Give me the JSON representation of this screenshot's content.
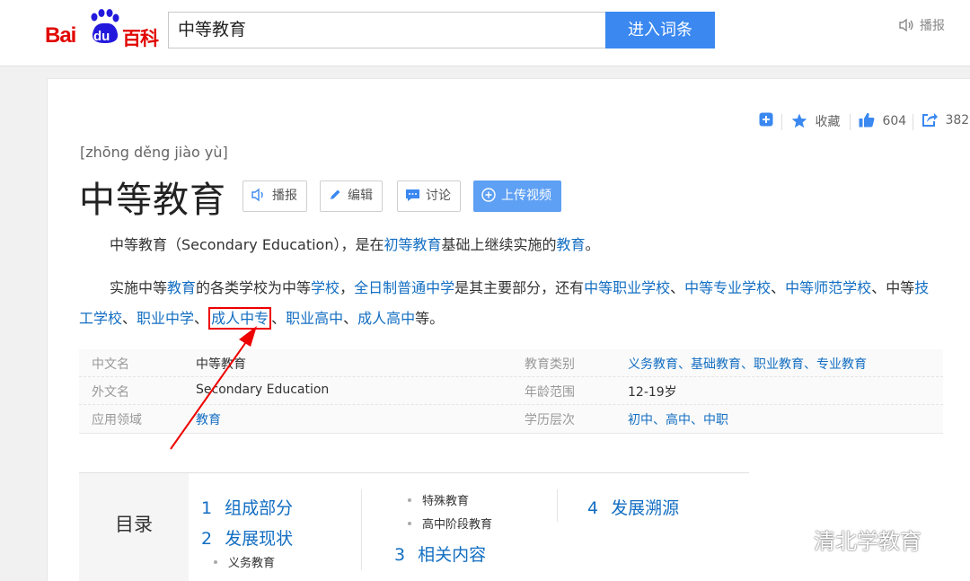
{
  "header": {
    "logo_bai": "Bai",
    "logo_du": "du",
    "logo_baike": "百科",
    "search_value": "中等教育",
    "search_button": "进入词条",
    "broadcast": "播报"
  },
  "tools": {
    "favorite": "收藏",
    "likes": "604",
    "shares": "382"
  },
  "entry": {
    "pinyin": "[zhōng děng jiào yù]",
    "title": "中等教育",
    "buttons": {
      "broadcast": "播报",
      "edit": "编辑",
      "discuss": "讨论",
      "upload_video": "上传视频"
    }
  },
  "summary": {
    "p1": {
      "t1": "中等教育（Secondary Education），是在",
      "l1": "初等教育",
      "t2": "基础上继续实施的",
      "l2": "教育",
      "t3": "。"
    },
    "p2": {
      "t1": "实施中等",
      "l1": "教育",
      "t2": "的各类学校为中等",
      "l2": "学校",
      "t3": "，",
      "l3": "全日制普通中学",
      "t4": "是其主要部分，还有",
      "l4": "中等职业学校",
      "t5": "、",
      "l5": "中等专业学校",
      "t6": "、",
      "l6": "中等师范学校",
      "t7": "、中等",
      "l7": "技工学校",
      "t8": "、",
      "l8": "职业中学",
      "t9": "、",
      "l9": "成人中专",
      "t10": "、",
      "l10": "职业高中",
      "t11": "、",
      "l11": "成人高中",
      "t12": "等。"
    }
  },
  "infobox": [
    {
      "k1": "中文名",
      "v1": "中等教育",
      "k2": "教育类别",
      "v2": "义务教育、基础教育、职业教育、专业教育"
    },
    {
      "k1": "外文名",
      "v1": "Secondary Education",
      "k2": "年龄范围",
      "v2": "12-19岁"
    },
    {
      "k1": "应用领域",
      "v1": "教育",
      "k2": "学历层次",
      "v2": "初中、高中、中职"
    }
  ],
  "toc": {
    "heading": "目录",
    "items": [
      {
        "num": "1",
        "label": "组成部分"
      },
      {
        "num": "2",
        "label": "发展现状"
      },
      {
        "num": "3",
        "label": "相关内容"
      },
      {
        "num": "4",
        "label": "发展溯源"
      }
    ],
    "subs": [
      "义务教育",
      "特殊教育",
      "高中阶段教育"
    ]
  },
  "watermark": "清北学教育",
  "colors": {
    "brand_red": "#e10601",
    "link": "#136ec2",
    "search_button": "#3a88f0",
    "highlight_box": "#ee0000"
  }
}
